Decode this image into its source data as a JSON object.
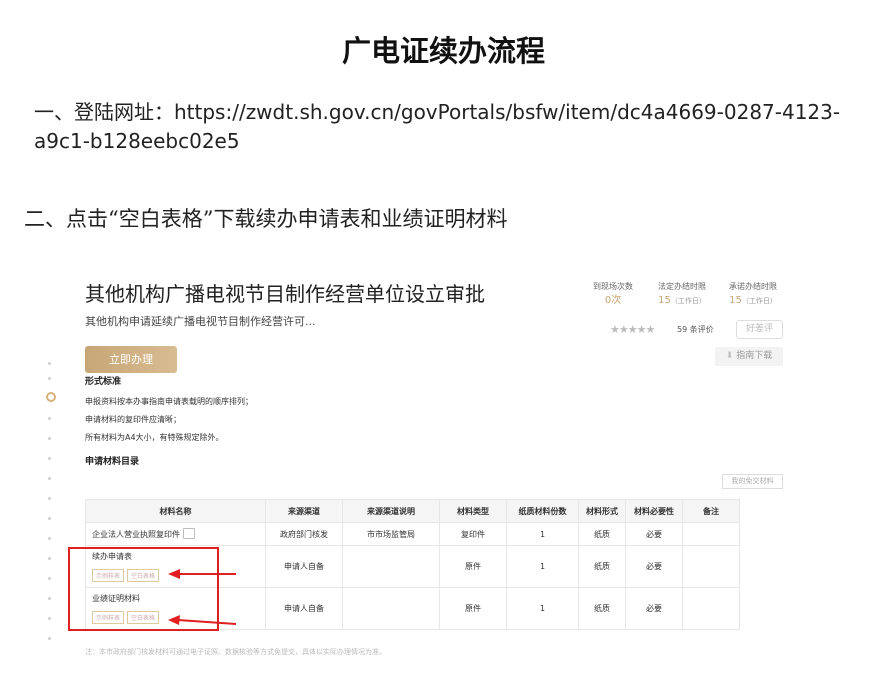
{
  "doc": {
    "title": "广电证续办流程",
    "step1": "一、登陆网址：https://zwdt.sh.gov.cn/govPortals/bsfw/item/dc4a4669-0287-4123-a9c1-b128eebc02e5",
    "step2": "二、点击“空白表格”下载续办申请表和业绩证明材料"
  },
  "service": {
    "title": "其他机构广播电视节目制作经营单位设立审批",
    "subtitle": "其他机构申请延续广播电视节目制作经营许可...",
    "stats": [
      {
        "label": "到现场次数",
        "value": "0",
        "unit": "次"
      },
      {
        "label": "法定办结时限",
        "value": "15",
        "unit": "（工作日）"
      },
      {
        "label": "承诺办结时限",
        "value": "15",
        "unit": "（工作日）"
      }
    ],
    "stars": "★★★★★",
    "rating_text": "59 条评价",
    "good_review_button": "好差评",
    "guide_download": "指南下载",
    "apply_button": "立即办理"
  },
  "form_standard": {
    "heading": "形式标准",
    "items": [
      "申报资料按本办事指南申请表载明的顺序排列；",
      "申请材料的复印件应清晰；",
      "所有材料为A4大小，有特殊规定除外。"
    ]
  },
  "materials": {
    "heading": "申请材料目录",
    "waiver_button": "我的免交材料",
    "columns": [
      "材料名称",
      "来源渠道",
      "来源渠道说明",
      "材料类型",
      "纸质材料份数",
      "材料形式",
      "材料必要性",
      "备注"
    ],
    "rows": [
      {
        "name": "企业法人营业执照复印件",
        "source": "政府部门核发",
        "source_desc": "市市场监管局",
        "type": "复印件",
        "copies": "1",
        "form": "纸质",
        "necessity": "必要",
        "remark": "",
        "sample": "",
        "blank": ""
      },
      {
        "name": "续办申请表",
        "source": "申请人自备",
        "source_desc": "",
        "type": "原件",
        "copies": "1",
        "form": "纸质",
        "necessity": "必要",
        "remark": "",
        "sample": "示例样表",
        "blank": "空白表格"
      },
      {
        "name": "业绩证明材料",
        "source": "申请人自备",
        "source_desc": "",
        "type": "原件",
        "copies": "1",
        "form": "纸质",
        "necessity": "必要",
        "remark": "",
        "sample": "示例样表",
        "blank": "空白表格"
      }
    ],
    "note": "注：本市政府部门核发材料可通过电子证照、数据核验等方式免提交，具体以实际办理情况为准。"
  },
  "colors": {
    "accent": "#c9a472",
    "highlight": "#e02020"
  }
}
